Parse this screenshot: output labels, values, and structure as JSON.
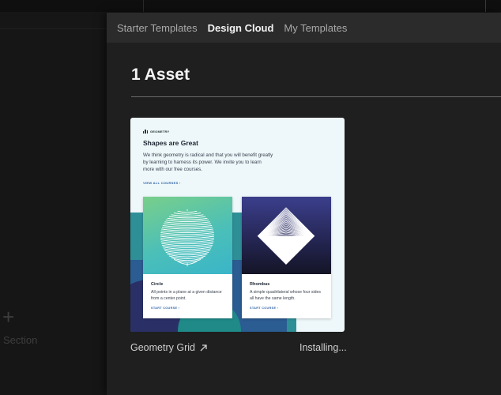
{
  "background": {
    "add_section_label": "Section",
    "plus_glyph": "+"
  },
  "modal": {
    "tabs": [
      {
        "label": "Starter Templates",
        "active": false
      },
      {
        "label": "Design Cloud",
        "active": true
      },
      {
        "label": "My Templates",
        "active": false
      }
    ],
    "heading": "1 Asset"
  },
  "asset": {
    "name": "Geometry Grid",
    "link_icon": "external-link-arrow-icon",
    "status": "Installing...",
    "preview": {
      "brand": "GEOMETRY",
      "title": "Shapes are Great",
      "description": "We think geometry is radical and that you will benefit greatly by learning to harness its power. We invite you to learn more with our free courses.",
      "link": "VIEW ALL COURSES  ›",
      "cards": [
        {
          "title": "Circle",
          "description": "All points in a plane at a given distance from a center point.",
          "link": "START COURSE  ›",
          "shape": "circle-lines"
        },
        {
          "title": "Rhombus",
          "description": "A simple quadrilateral whose four sides all have the same length.",
          "link": "START COURSE  ›",
          "shape": "rhombus-lines"
        }
      ]
    }
  },
  "colors": {
    "modal_bg": "#1f1f1f",
    "tabbar_bg": "#2b2b2b",
    "accent_link": "#2f63a8"
  }
}
